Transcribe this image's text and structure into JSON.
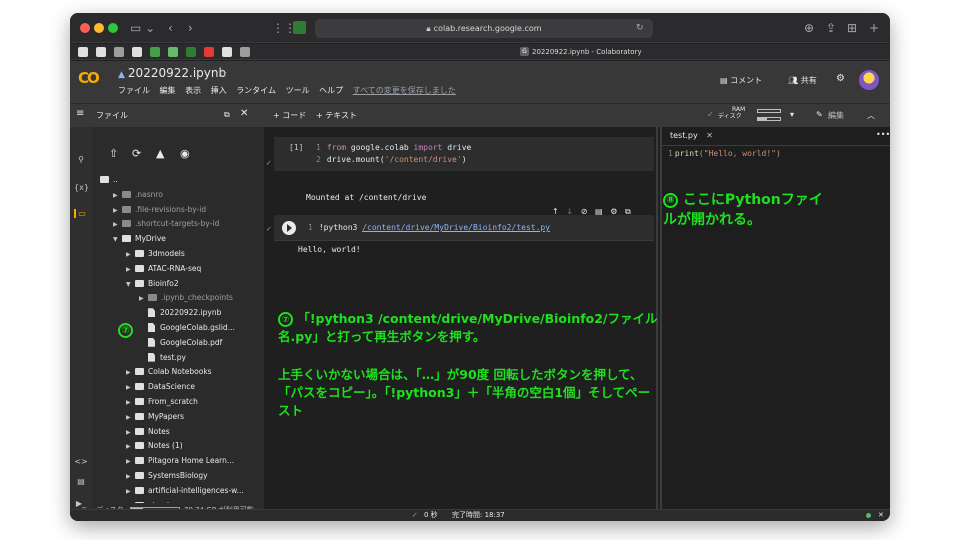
{
  "browser": {
    "url": "colab.research.google.com",
    "tab_title": "20220922.ipynb - Colaboratory"
  },
  "colab": {
    "logo": "CO",
    "notebook_name": "20220922.ipynb",
    "menus": [
      "ファイル",
      "編集",
      "表示",
      "挿入",
      "ランタイム",
      "ツール",
      "ヘルプ"
    ],
    "saved_status": "すべての変更を保存しました",
    "comment_label": "コメント",
    "share_label": "共有"
  },
  "toolbar": {
    "add_code": "+ コード",
    "add_text": "+ テキスト",
    "ram_label": "RAM",
    "disk_label": "ディスク",
    "edit_label": "編集"
  },
  "filepanel": {
    "title": "ファイル",
    "items": [
      {
        "label": "..",
        "type": "folder",
        "depth": 0,
        "dim": false
      },
      {
        "label": ".nasnro",
        "type": "folder",
        "depth": 1,
        "dim": true
      },
      {
        "label": ".file-revisions-by-id",
        "type": "folder",
        "depth": 1,
        "dim": true
      },
      {
        "label": ".shortcut-targets-by-id",
        "type": "folder",
        "depth": 1,
        "dim": true
      },
      {
        "label": "MyDrive",
        "type": "folder",
        "depth": 1,
        "dim": false,
        "open": true
      },
      {
        "label": "3dmodels",
        "type": "folder",
        "depth": 2,
        "dim": false
      },
      {
        "label": "ATAC-RNA-seq",
        "type": "folder",
        "depth": 2,
        "dim": false
      },
      {
        "label": "Bioinfo2",
        "type": "folder",
        "depth": 2,
        "dim": false,
        "open": true
      },
      {
        "label": ".ipynb_checkpoints",
        "type": "folder",
        "depth": 3,
        "dim": true
      },
      {
        "label": "20220922.ipynb",
        "type": "file",
        "depth": 3,
        "dim": false
      },
      {
        "label": "GoogleColab.gslid...",
        "type": "file",
        "depth": 3,
        "dim": false
      },
      {
        "label": "GoogleColab.pdf",
        "type": "file",
        "depth": 3,
        "dim": false
      },
      {
        "label": "test.py",
        "type": "file",
        "depth": 3,
        "dim": false
      },
      {
        "label": "Colab Notebooks",
        "type": "folder",
        "depth": 2,
        "dim": false
      },
      {
        "label": "DataScience",
        "type": "folder",
        "depth": 2,
        "dim": false
      },
      {
        "label": "From_scratch",
        "type": "folder",
        "depth": 2,
        "dim": false
      },
      {
        "label": "MyPapers",
        "type": "folder",
        "depth": 2,
        "dim": false
      },
      {
        "label": "Notes",
        "type": "folder",
        "depth": 2,
        "dim": false
      },
      {
        "label": "Notes (1)",
        "type": "folder",
        "depth": 2,
        "dim": false
      },
      {
        "label": "Pitagora Home Learn...",
        "type": "folder",
        "depth": 2,
        "dim": false
      },
      {
        "label": "SystemsBiology",
        "type": "folder",
        "depth": 2,
        "dim": false
      },
      {
        "label": "artificial-intelligences-w...",
        "type": "folder",
        "depth": 2,
        "dim": false
      },
      {
        "label": "atcoder",
        "type": "folder",
        "depth": 2,
        "dim": false
      }
    ],
    "disk_label": "ディスク",
    "disk_free": "70.74 GB が利用可能"
  },
  "cell1": {
    "prompt": "[1]",
    "line1_no": "1",
    "line1_a": "from",
    "line1_b": " google.colab ",
    "line1_c": "import",
    "line1_d": " drive",
    "line2_no": "2",
    "line2_a": "drive.mount(",
    "line2_b": "'/content/drive'",
    "line2_c": ")",
    "output": "Mounted at /content/drive"
  },
  "cell2": {
    "line_no": "1",
    "cmd": "!python3 ",
    "path": "/content/drive/MyDrive/Bioinfo2/test.py",
    "output": "Hello, world!"
  },
  "editor": {
    "tab": "test.py",
    "line_no": "1",
    "fn": "print",
    "arg": "(\"Hello, world!\")"
  },
  "status": {
    "elapsed": "0 秒",
    "completed": "完了時間: 18:37"
  },
  "annotations": {
    "n7": "⑦",
    "n8": "⑧",
    "step8_line1": "ここにPythonファイ",
    "step8_line2": "ルが開かれる。",
    "step7_line1": "「!python3 /content/drive/MyDrive/Bioinfo2/ファイル",
    "step7_line2": "名.py」と打って再生ボタンを押す。",
    "note_line1": "上手くいかない場合は、「…」が90度 回転したボタンを押して、",
    "note_line2": "「パスをコピー」。「!python3」＋「半角の空白1個」そしてペー",
    "note_line3": "スト"
  },
  "colors": {
    "annotation": "#1ee01e",
    "colab_orange": "#f9ab00",
    "string_path": "#8ab4f8"
  }
}
